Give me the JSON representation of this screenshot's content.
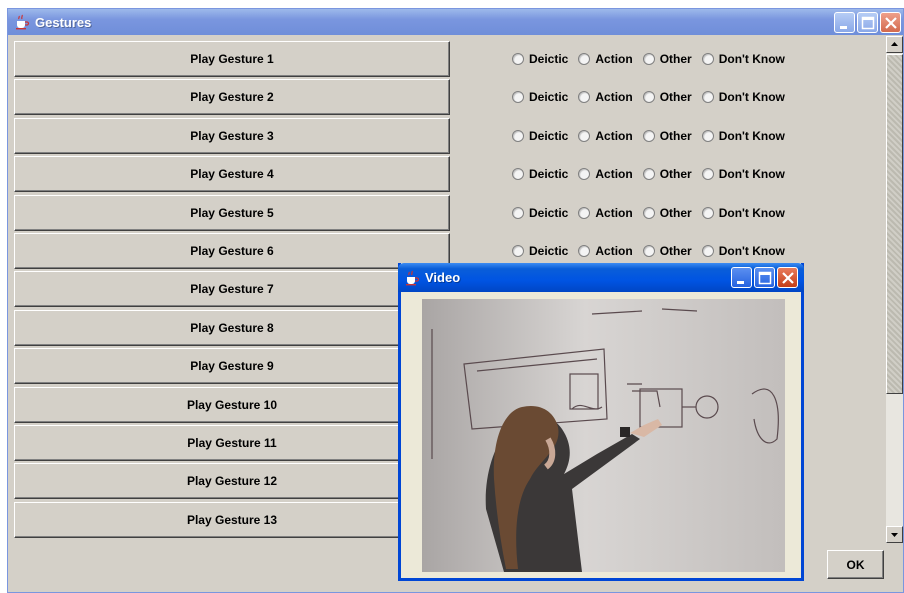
{
  "main_window": {
    "title": "Gestures",
    "icon": "java-cup-icon",
    "ok_label": "OK"
  },
  "radio_options": [
    "Deictic",
    "Action",
    "Other",
    "Don't Know"
  ],
  "gestures": [
    {
      "label": "Play Gesture 1"
    },
    {
      "label": "Play Gesture 2"
    },
    {
      "label": "Play Gesture 3"
    },
    {
      "label": "Play Gesture 4"
    },
    {
      "label": "Play Gesture 5"
    },
    {
      "label": "Play Gesture 6"
    },
    {
      "label": "Play Gesture 7"
    },
    {
      "label": "Play Gesture 8"
    },
    {
      "label": "Play Gesture 9"
    },
    {
      "label": "Play Gesture 10"
    },
    {
      "label": "Play Gesture 11"
    },
    {
      "label": "Play Gesture 12"
    },
    {
      "label": "Play Gesture 13"
    }
  ],
  "video_window": {
    "title": "Video",
    "icon": "java-cup-icon",
    "content": "video-frame"
  },
  "colors": {
    "active_title": "#0054e3",
    "inactive_title": "#7a96df",
    "window_bg": "#d4d0c8"
  }
}
